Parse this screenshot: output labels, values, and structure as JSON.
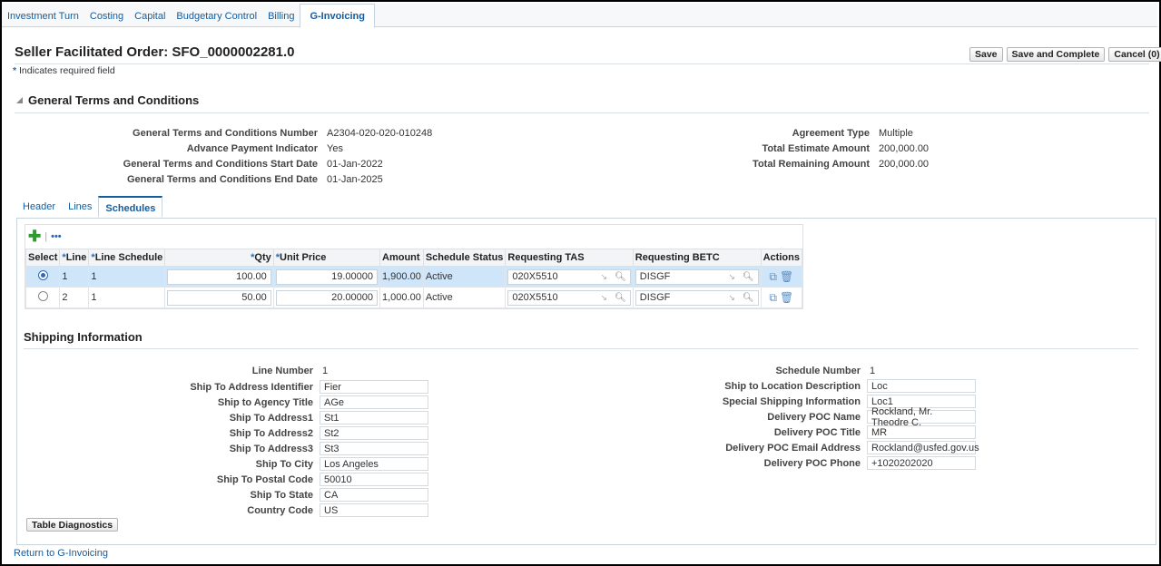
{
  "nav_tabs": [
    "Investment Turn",
    "Costing",
    "Capital",
    "Budgetary Control",
    "Billing",
    "G-Invoicing"
  ],
  "active_nav_tab": "G-Invoicing",
  "page_title": "Seller Facilitated Order: SFO_0000002281.0",
  "required_note": "Indicates required field",
  "buttons": {
    "save": "Save",
    "save_complete": "Save and Complete",
    "cancel": "Cancel (0)",
    "table_diagnostics": "Table Diagnostics"
  },
  "section_title": "General Terms and Conditions",
  "gtc_left": [
    {
      "label": "General Terms and Conditions Number",
      "value": "A2304-020-020-010248"
    },
    {
      "label": "Advance Payment Indicator",
      "value": "Yes"
    },
    {
      "label": "General Terms and Conditions Start Date",
      "value": "01-Jan-2022"
    },
    {
      "label": "General Terms and Conditions End Date",
      "value": "01-Jan-2025"
    }
  ],
  "gtc_right": [
    {
      "label": "Agreement Type",
      "value": "Multiple"
    },
    {
      "label": "Total Estimate Amount",
      "value": "200,000.00"
    },
    {
      "label": "Total Remaining Amount",
      "value": "200,000.00"
    }
  ],
  "sub_tabs": [
    "Header",
    "Lines",
    "Schedules"
  ],
  "active_sub_tab": "Schedules",
  "table": {
    "columns": [
      "Select",
      "Line",
      "Line Schedule",
      "Qty",
      "Unit Price",
      "Amount",
      "Schedule Status",
      "Requesting TAS",
      "Requesting BETC",
      "Actions"
    ],
    "rows": [
      {
        "selected": true,
        "line": "1",
        "schedule": "1",
        "qty": "100.00",
        "unit_price": "19.00000",
        "amount": "1,900.00",
        "status": "Active",
        "tas": "020X5510",
        "betc": "DISGF"
      },
      {
        "selected": false,
        "line": "2",
        "schedule": "1",
        "qty": "50.00",
        "unit_price": "20.00000",
        "amount": "1,000.00",
        "status": "Active",
        "tas": "020X5510",
        "betc": "DISGF"
      }
    ]
  },
  "shipping_title": "Shipping Information",
  "shipping_left": [
    {
      "label": "Line Number",
      "value": "1",
      "input": false
    },
    {
      "label": "Ship To Address Identifier",
      "value": "Fier",
      "input": true
    },
    {
      "label": "Ship to Agency Title",
      "value": "AGe",
      "input": true
    },
    {
      "label": "Ship To Address1",
      "value": "St1",
      "input": true
    },
    {
      "label": "Ship To Address2",
      "value": "St2",
      "input": true
    },
    {
      "label": "Ship To Address3",
      "value": "St3",
      "input": true
    },
    {
      "label": "Ship To City",
      "value": "Los Angeles",
      "input": true
    },
    {
      "label": "Ship To Postal Code",
      "value": "50010",
      "input": true
    },
    {
      "label": "Ship To State",
      "value": "CA",
      "input": true
    },
    {
      "label": "Country Code",
      "value": "US",
      "input": true
    }
  ],
  "shipping_right": [
    {
      "label": "Schedule Number",
      "value": "1",
      "input": false
    },
    {
      "label": "Ship to Location Description",
      "value": "Loc",
      "input": true
    },
    {
      "label": "Special Shipping Information",
      "value": "Loc1",
      "input": true
    },
    {
      "label": "Delivery POC Name",
      "value": "Rockland, Mr. Theodre C.",
      "input": true
    },
    {
      "label": "Delivery POC Title",
      "value": "MR",
      "input": true
    },
    {
      "label": "Delivery POC Email Address",
      "value": "Rockland@usfed.gov.us",
      "input": true
    },
    {
      "label": "Delivery POC Phone",
      "value": "+1020202020",
      "input": true
    }
  ],
  "return_link": "Return to G-Invoicing",
  "colors": {
    "link": "#145c9e",
    "selected_row": "#cfe6fa",
    "required": "#2a6bb7"
  }
}
